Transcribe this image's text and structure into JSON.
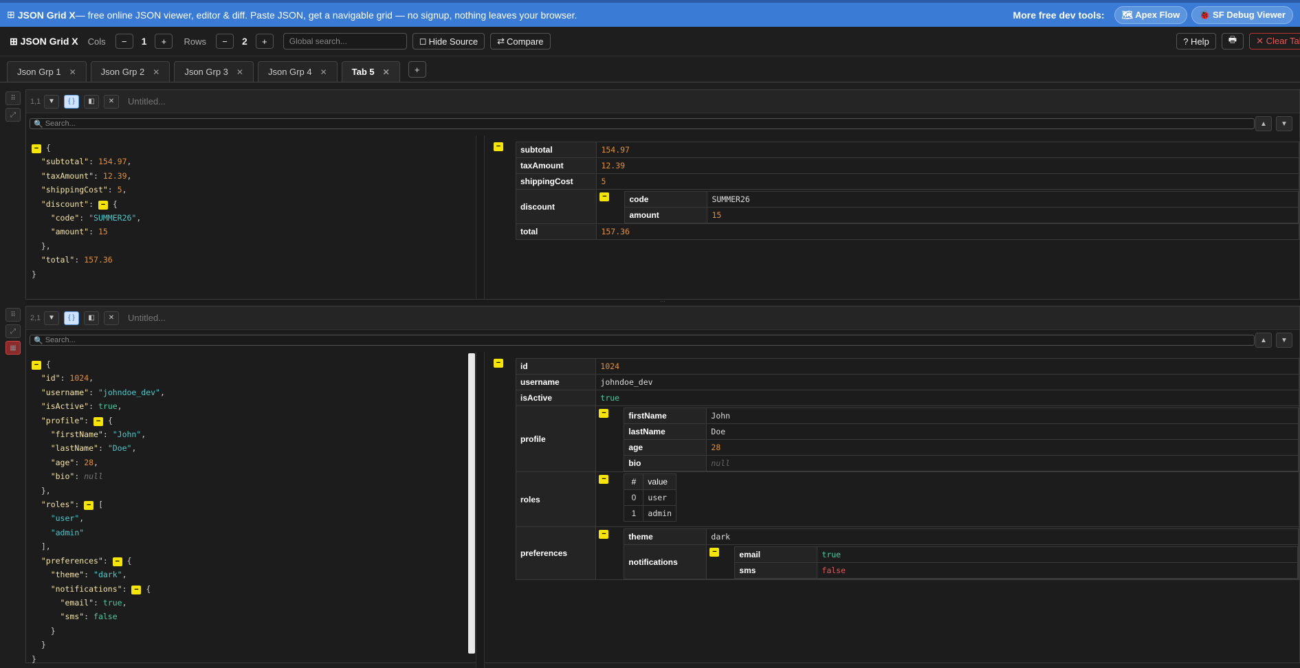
{
  "banner": {
    "title": "JSON Grid X",
    "tagline": " — free online JSON viewer, editor & diff. Paste JSON, get a navigable grid — no signup, nothing leaves your browser.",
    "more_label": "More free dev tools:",
    "apex_label": "Apex Flow",
    "sfdebug_label": "SF Debug Viewer"
  },
  "toolbar": {
    "logo": "JSON Grid X",
    "cols_label": "Cols",
    "cols_value": "1",
    "rows_label": "Rows",
    "rows_value": "2",
    "search_placeholder": "Global search...",
    "hide_source_label": "Hide Source",
    "compare_label": "Compare",
    "help_label": "? Help",
    "clear_label": "✕ Clear Tab"
  },
  "tabs": [
    {
      "label": "Json Grp 1"
    },
    {
      "label": "Json Grp 2"
    },
    {
      "label": "Json Grp 3"
    },
    {
      "label": "Json Grp 4"
    },
    {
      "label": "Tab 5"
    }
  ],
  "panels": [
    {
      "id": "1,1",
      "title": "Untitled...",
      "search_placeholder": "Search...",
      "grid": {
        "subtotal": "154.97",
        "taxAmount": "12.39",
        "shippingCost": "5",
        "discount_code": "SUMMER26",
        "discount_amount": "15",
        "total": "157.36"
      }
    },
    {
      "id": "2,1",
      "title": "Untitled...",
      "search_placeholder": "Search...",
      "grid": {
        "id": "1024",
        "username": "johndoe_dev",
        "isActive": "true",
        "firstName": "John",
        "lastName": "Doe",
        "age": "28",
        "bio": "null",
        "roles_hdr_idx": "#",
        "roles_hdr_val": "value",
        "role0": "user",
        "role1": "admin",
        "theme": "dark",
        "email": "true",
        "sms": "false"
      }
    }
  ]
}
